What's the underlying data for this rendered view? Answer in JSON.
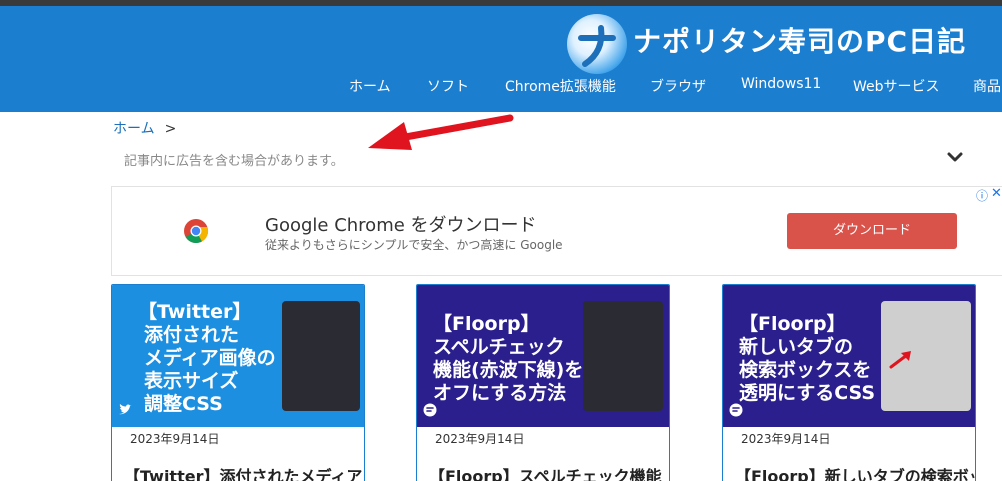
{
  "site": {
    "title": "ナポリタン寿司のPC日記",
    "logo_letter": "ナ"
  },
  "nav": {
    "items": [
      {
        "label": "ホーム"
      },
      {
        "label": "ソフト"
      },
      {
        "label": "Chrome拡張機能"
      },
      {
        "label": "ブラウザ"
      },
      {
        "label": "Windows11"
      },
      {
        "label": "Webサービス"
      },
      {
        "label": "商品"
      }
    ]
  },
  "breadcrumb": {
    "home": "ホーム",
    "separator": ">"
  },
  "notice": {
    "text": "記事内に広告を含む場合があります。"
  },
  "ad": {
    "title": "Google Chrome をダウンロード",
    "subtitle": "従来よりもさらにシンプルで安全、かつ高速に Google",
    "button": "ダウンロード",
    "info_icon": "ⓘ",
    "close_icon": "✕"
  },
  "cards": [
    {
      "thumb_lines": [
        "【Twitter】",
        "添付された",
        "メディア画像の",
        "表示サイズ",
        "調整CSS"
      ],
      "date": "2023年9月14日",
      "title": "【Twitter】添付されたメディア"
    },
    {
      "thumb_lines": [
        "【Floorp】",
        "スペルチェック",
        "機能(赤波下線)を",
        "オフにする方法"
      ],
      "date": "2023年9月14日",
      "title": "【Floorp】スペルチェック機能"
    },
    {
      "thumb_lines": [
        "【Floorp】",
        "新しいタブの",
        "検索ボックスを",
        "透明にするCSS"
      ],
      "date": "2023年9月14日",
      "title": "【Floorp】新しいタブの検索ボッ"
    }
  ],
  "colors": {
    "header": "#1c7ecf",
    "card_border": "#1c7ecf",
    "twitter_thumb": "#1d8fe0",
    "floorp_thumb": "#2a1f8c",
    "ad_button": "#d9534a",
    "arrow": "#e0141e"
  }
}
